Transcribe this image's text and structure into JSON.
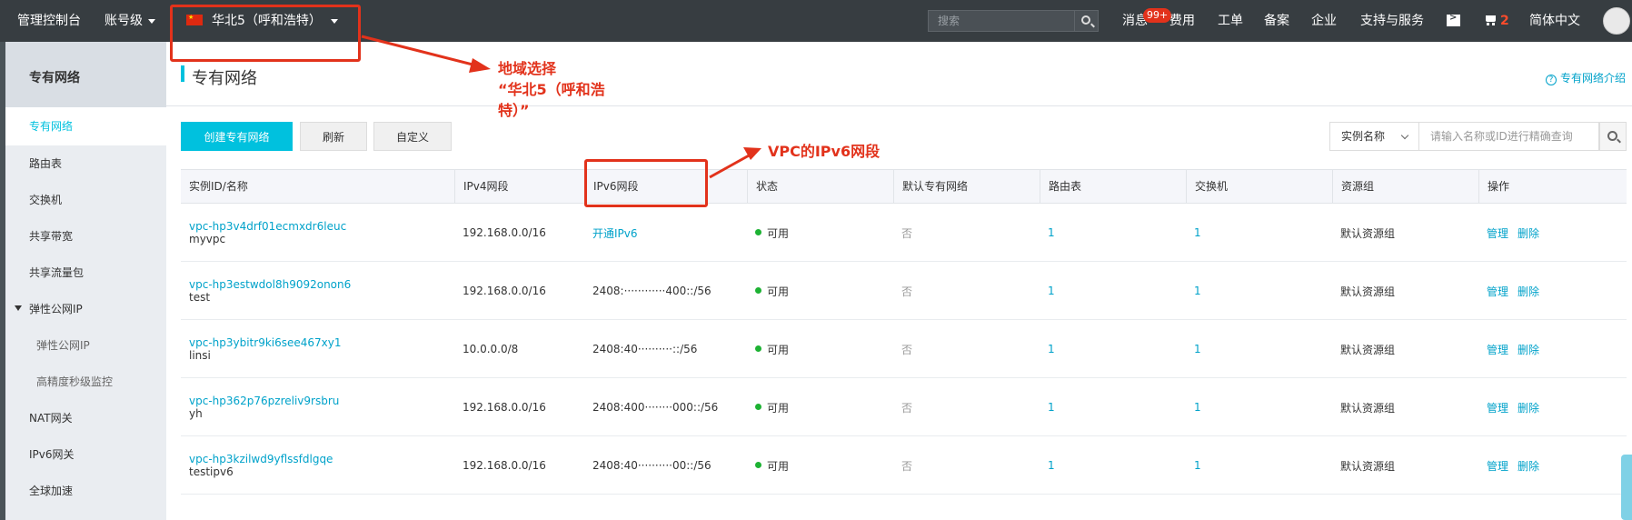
{
  "topbar": {
    "console": "管理控制台",
    "account": "账号级",
    "region": "华北5（呼和浩特）",
    "search_placeholder": "搜索",
    "messages": "消息",
    "messages_badge": "99+",
    "billing": "费用",
    "tickets": "工单",
    "icp": "备案",
    "enterprise": "企业",
    "support": "支持与服务",
    "cart_count": "2",
    "language": "简体中文"
  },
  "sidebar": {
    "title": "专有网络",
    "items": [
      {
        "label": "专有网络"
      },
      {
        "label": "路由表"
      },
      {
        "label": "交换机"
      },
      {
        "label": "共享带宽"
      },
      {
        "label": "共享流量包"
      },
      {
        "label": "弹性公网IP"
      },
      {
        "label": "弹性公网IP"
      },
      {
        "label": "高精度秒级监控"
      },
      {
        "label": "NAT网关"
      },
      {
        "label": "IPv6网关"
      },
      {
        "label": "全球加速"
      }
    ]
  },
  "main": {
    "title": "专有网络",
    "help_link": "专有网络介绍",
    "toolbar": {
      "create": "创建专有网络",
      "refresh": "刷新",
      "customize": "自定义",
      "filter_select": "实例名称",
      "filter_placeholder": "请输入名称或ID进行精确查询"
    },
    "table": {
      "columns": [
        "实例ID/名称",
        "IPv4网段",
        "IPv6网段",
        "状态",
        "默认专有网络",
        "路由表",
        "交换机",
        "资源组",
        "操作"
      ],
      "rows": [
        {
          "id": "vpc-hp3v4drf01ecmxdr6leuc",
          "name": "myvpc",
          "ipv4": "192.168.0.0/16",
          "ipv6": "开通IPv6",
          "status": "可用",
          "default": "否",
          "route": "1",
          "vswitch": "1",
          "group": "默认资源组",
          "manage": "管理",
          "delete": "删除"
        },
        {
          "id": "vpc-hp3estwdol8h9092onon6",
          "name": "test",
          "ipv4": "192.168.0.0/16",
          "ipv6": "2408:············400::/56",
          "status": "可用",
          "default": "否",
          "route": "1",
          "vswitch": "1",
          "group": "默认资源组",
          "manage": "管理",
          "delete": "删除"
        },
        {
          "id": "vpc-hp3ybitr9ki6see467xy1",
          "name": "linsi",
          "ipv4": "10.0.0.0/8",
          "ipv6": "2408:40··········::/56",
          "status": "可用",
          "default": "否",
          "route": "1",
          "vswitch": "1",
          "group": "默认资源组",
          "manage": "管理",
          "delete": "删除"
        },
        {
          "id": "vpc-hp362p76pzreliv9rsbru",
          "name": "yh",
          "ipv4": "192.168.0.0/16",
          "ipv6": "2408:400········000::/56",
          "status": "可用",
          "default": "否",
          "route": "1",
          "vswitch": "1",
          "group": "默认资源组",
          "manage": "管理",
          "delete": "删除"
        },
        {
          "id": "vpc-hp3kzilwd9yflssfdlgqe",
          "name": "testipv6",
          "ipv4": "192.168.0.0/16",
          "ipv6": "2408:40··········00::/56",
          "status": "可用",
          "default": "否",
          "route": "1",
          "vswitch": "1",
          "group": "默认资源组",
          "manage": "管理",
          "delete": "删除"
        }
      ]
    }
  },
  "annotations": {
    "region_note_line1": "地域选择",
    "region_note_line2": "“华北5（呼和浩",
    "region_note_line3": "特）”",
    "ipv6_note": "VPC的IPv6网段"
  },
  "colors": {
    "topbar_bg": "#373d41",
    "accent": "#00c1de",
    "link": "#00a2ca",
    "annotation": "#e2321b",
    "status_ok": "#1db233"
  }
}
